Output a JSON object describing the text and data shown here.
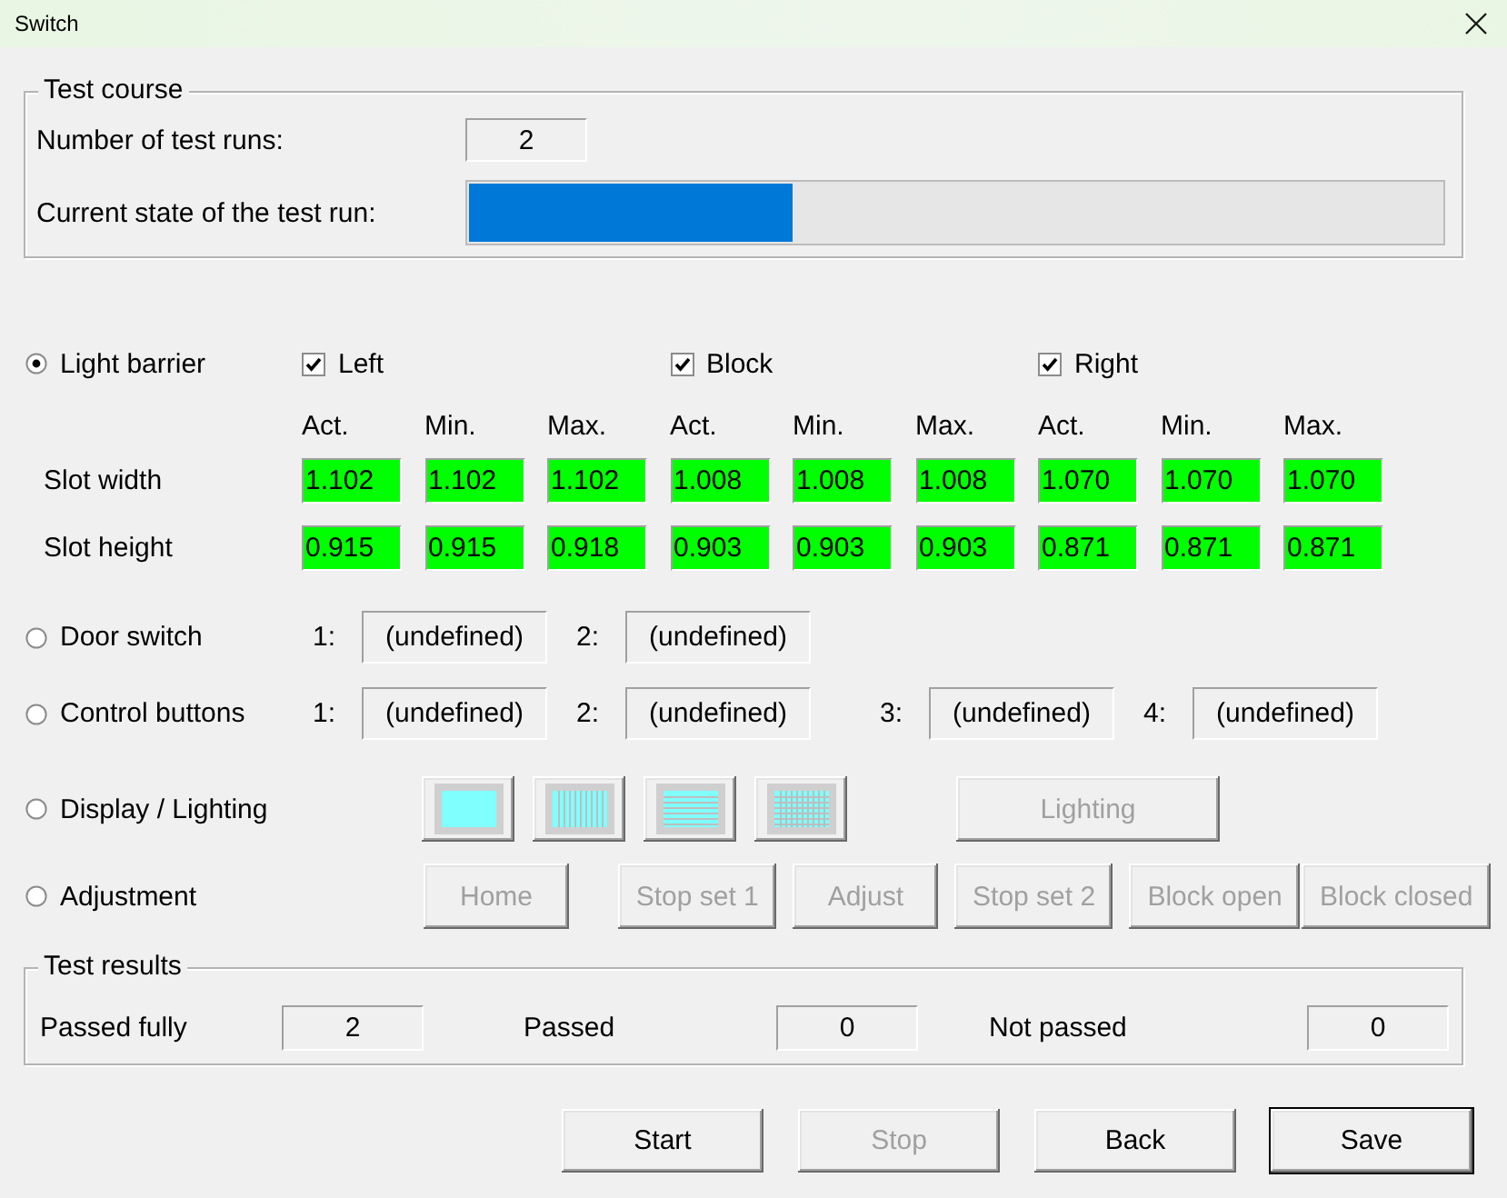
{
  "window": {
    "title": "Switch"
  },
  "test_course": {
    "title": "Test course",
    "runs_label": "Number of test runs:",
    "runs_value": "2",
    "state_label": "Current state of the test run:",
    "progress": {
      "level": 0.333
    }
  },
  "modes": [
    {
      "kind": "light_barrier",
      "label": "Light barrier",
      "selected": true,
      "sides": [
        {
          "label": "Left",
          "checked": true
        },
        {
          "label": "Block",
          "checked": true
        },
        {
          "label": "Right",
          "checked": true
        }
      ],
      "columns": [
        "Act.",
        "Min.",
        "Max.",
        "Act.",
        "Min.",
        "Max.",
        "Act.",
        "Min.",
        "Max."
      ],
      "rows": [
        {
          "label": "Slot width",
          "cells": [
            "1.102",
            "1.102",
            "1.102",
            "1.008",
            "1.008",
            "1.008",
            "1.070",
            "1.070",
            "1.070"
          ]
        },
        {
          "label": "Slot height",
          "cells": [
            "0.915",
            "0.915",
            "0.918",
            "0.903",
            "0.903",
            "0.903",
            "0.871",
            "0.871",
            "0.871"
          ]
        }
      ]
    },
    {
      "kind": "inputs",
      "label": "Door switch",
      "selected": false,
      "inputs": [
        {
          "number": "1:",
          "value": "(undefined)"
        },
        {
          "number": "2:",
          "value": "(undefined)"
        }
      ]
    },
    {
      "kind": "inputs",
      "label": "Control buttons",
      "selected": false,
      "inputs": [
        {
          "number": "1:",
          "value": "(undefined)"
        },
        {
          "number": "2:",
          "value": "(undefined)"
        },
        {
          "number": "3:",
          "value": "(undefined)"
        },
        {
          "number": "4:",
          "value": "(undefined)"
        }
      ]
    },
    {
      "kind": "display",
      "label": "Display / Lighting",
      "selected": false,
      "patterns": [
        {
          "kind": "solid"
        },
        {
          "kind": "vertical_stripes"
        },
        {
          "kind": "horizontal_stripes"
        },
        {
          "kind": "grid"
        }
      ],
      "lighting_button": {
        "label": "Lighting",
        "disabled": true
      }
    },
    {
      "kind": "adjustment",
      "label": "Adjustment",
      "selected": false,
      "buttons": [
        {
          "label": "Home",
          "disabled": true
        },
        {
          "label": "Stop set 1",
          "disabled": true
        },
        {
          "label": "Adjust",
          "disabled": true
        },
        {
          "label": "Stop set 2",
          "disabled": true
        },
        {
          "label": "Block open",
          "disabled": true
        },
        {
          "label": "Block closed",
          "disabled": true
        }
      ]
    }
  ],
  "test_results": {
    "title": "Test results",
    "items": [
      {
        "label": "Passed fully",
        "value": "2"
      },
      {
        "label": "Passed",
        "value": "0"
      },
      {
        "label": "Not passed",
        "value": "0"
      }
    ]
  },
  "footer_buttons": [
    {
      "label": "Start",
      "disabled": false,
      "default": false
    },
    {
      "label": "Stop",
      "disabled": true,
      "default": false
    },
    {
      "label": "Back",
      "disabled": false,
      "default": false
    },
    {
      "label": "Save",
      "disabled": false,
      "default": true
    }
  ]
}
